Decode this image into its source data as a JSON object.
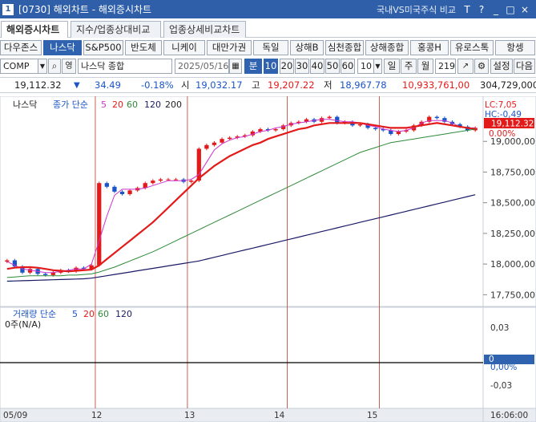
{
  "window": {
    "icon": "1",
    "title": "[0730] 해외차트 - 해외증시차트",
    "compare_link": "국내VS미국주식 비교",
    "controls": [
      "T",
      "?",
      "_",
      "□",
      "×"
    ]
  },
  "tabs": [
    {
      "label": "해외증시차트",
      "active": true
    },
    {
      "label": "지수/업종상대비교",
      "active": false
    },
    {
      "label": "업종상세비교차트",
      "active": false
    }
  ],
  "markets": [
    "다우존스",
    "나스닥",
    "S&P500",
    "반도체",
    "니케이",
    "대만가권",
    "독일",
    "상해B",
    "심천종합",
    "상해종합",
    "홍콩H",
    "유로스톡",
    "항셍"
  ],
  "selected_market": "나스닥",
  "controls": {
    "code": "COMP",
    "name": "나스닥 종합",
    "date": "2025/05/16",
    "period_label": "분",
    "intervals": [
      "10",
      "20",
      "30",
      "40",
      "50",
      "60"
    ],
    "selected_interval": "10",
    "count_select": "10",
    "day_buttons": [
      "일",
      "주",
      "월"
    ],
    "bars": "219",
    "settings": "설정",
    "next": "다음",
    "eng_toggle": "영"
  },
  "quote": {
    "price": "19,112.32",
    "change": "34.49",
    "change_pct": "-0.18%",
    "open_label": "시",
    "open": "19,032.17",
    "high_label": "고",
    "high": "19,207.22",
    "low_label": "저",
    "low": "18,967.78",
    "amount": "10,933,761,00",
    "volume": "304,729,000"
  },
  "colors": {
    "ma5": "#cc33cc",
    "ma20": "#e31a1a",
    "ma60": "#2e8b3a",
    "ma120": "#1a1a66",
    "up": "#e31a1a",
    "down": "#1a55c8"
  },
  "chart_data": {
    "type": "candlestick",
    "price_panel": {
      "name": "나스닥",
      "legend": {
        "label": "종가",
        "method": "단순",
        "periods": [
          "5",
          "20",
          "60",
          "120",
          "200"
        ]
      },
      "yticks": [
        "19,000,00",
        "18,750,00",
        "18,500,00",
        "18,250,00",
        "18,000,00",
        "17,750,00"
      ],
      "yrange": [
        17700,
        19250
      ],
      "lc_label": "LC:7,05",
      "hc_label": "HC:-0,49",
      "last_price": "19,112.32",
      "last_pct": "0.00%",
      "close_series": [
        18030,
        17980,
        17930,
        17960,
        17920,
        17910,
        17930,
        17950,
        17940,
        17970,
        17960,
        17990,
        18660,
        18630,
        18590,
        18570,
        18600,
        18620,
        18660,
        18680,
        18690,
        18690,
        18690,
        18670,
        18680,
        18940,
        18970,
        18990,
        19020,
        19030,
        19040,
        19050,
        19080,
        19100,
        19090,
        19100,
        19130,
        19150,
        19160,
        19180,
        19160,
        19190,
        19200,
        19150,
        19160,
        19130,
        19140,
        19110,
        19100,
        19090,
        19060,
        19080,
        19090,
        19130,
        19160,
        19200,
        19190,
        19160,
        19140,
        19120,
        19090,
        19110
      ],
      "ma_series": {
        "5": [
          18020,
          17990,
          17960,
          17950,
          17940,
          17930,
          17930,
          17940,
          17950,
          17960,
          17960,
          18000,
          18190,
          18390,
          18560,
          18610,
          18610,
          18610,
          18620,
          18640,
          18660,
          18680,
          18680,
          18680,
          18690,
          18730,
          18830,
          18930,
          18980,
          19010,
          19030,
          19040,
          19060,
          19080,
          19090,
          19110,
          19120,
          19140,
          19150,
          19160,
          19170,
          19180,
          19180,
          19170,
          19160,
          19160,
          19150,
          19130,
          19120,
          19100,
          19090,
          19080,
          19090,
          19110,
          19150,
          19170,
          19170,
          19170,
          19150,
          19120,
          19110,
          19110
        ],
        "20": [
          17960,
          17970,
          17975,
          17975,
          17970,
          17960,
          17950,
          17945,
          17940,
          17945,
          17950,
          17955,
          17990,
          18040,
          18090,
          18140,
          18190,
          18240,
          18290,
          18340,
          18400,
          18460,
          18520,
          18580,
          18640,
          18700,
          18750,
          18800,
          18840,
          18880,
          18910,
          18940,
          18970,
          18990,
          19020,
          19040,
          19060,
          19080,
          19100,
          19110,
          19130,
          19140,
          19150,
          19150,
          19150,
          19150,
          19150,
          19140,
          19130,
          19120,
          19110,
          19110,
          19110,
          19120,
          19130,
          19140,
          19150,
          19140,
          19130,
          19120,
          19110,
          19100
        ],
        "60": [
          17890,
          17895,
          17900,
          17905,
          17905,
          17905,
          17905,
          17905,
          17910,
          17910,
          17915,
          17920,
          17935,
          17955,
          17975,
          18000,
          18025,
          18050,
          18075,
          18100,
          18130,
          18160,
          18190,
          18220,
          18250,
          18280,
          18310,
          18340,
          18370,
          18400,
          18430,
          18460,
          18490,
          18520,
          18550,
          18580,
          18610,
          18640,
          18670,
          18700,
          18730,
          18760,
          18790,
          18820,
          18850,
          18880,
          18910,
          18930,
          18950,
          18970,
          18990,
          19000,
          19010,
          19020,
          19030,
          19040,
          19050,
          19060,
          19070,
          19080,
          19090,
          19100
        ],
        "120": [
          17860,
          17862,
          17864,
          17866,
          17868,
          17870,
          17872,
          17874,
          17876,
          17878,
          17880,
          17885,
          17895,
          17905,
          17915,
          17925,
          17935,
          17945,
          17955,
          17965,
          17975,
          17985,
          17995,
          18005,
          18015,
          18025,
          18040,
          18055,
          18070,
          18085,
          18100,
          18115,
          18130,
          18145,
          18160,
          18175,
          18190,
          18205,
          18220,
          18235,
          18250,
          18265,
          18280,
          18295,
          18310,
          18325,
          18340,
          18355,
          18370,
          18385,
          18400,
          18415,
          18430,
          18445,
          18460,
          18475,
          18490,
          18505,
          18520,
          18535,
          18550,
          18565
        ]
      },
      "x_labels": [
        "05/09",
        "12",
        "13",
        "14",
        "15"
      ],
      "session_breaks": [
        12,
        24,
        37,
        49
      ]
    },
    "volume_panel": {
      "name": "거래량",
      "legend": {
        "method": "단순",
        "periods": [
          "5",
          "20",
          "60",
          "120"
        ]
      },
      "value_label": "0주(N/A)",
      "yticks": [
        "0,03",
        "0,00%",
        "-0,03"
      ],
      "current": "0"
    },
    "time_label": "16:06:00"
  }
}
